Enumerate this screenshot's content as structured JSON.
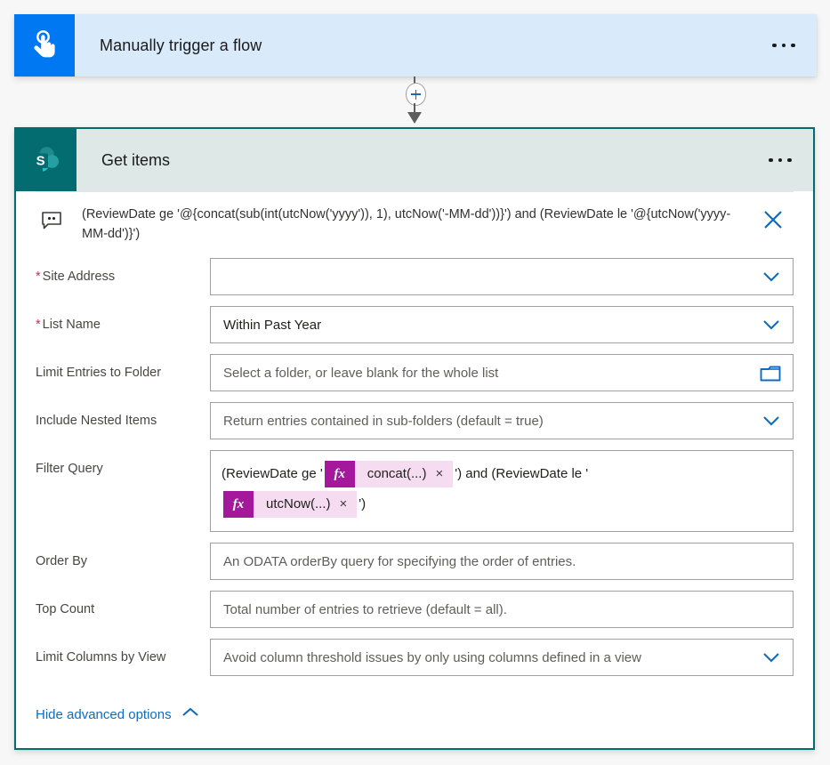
{
  "trigger": {
    "title": "Manually trigger a flow",
    "icon": "hand-tap-icon",
    "icon_bg": "#0078f2",
    "header_bg": "#d9eafa",
    "menu_label": "More commands"
  },
  "connector": {
    "add_label": "+",
    "icon": "plus-icon",
    "accent": "#0f6cbd"
  },
  "action": {
    "title": "Get items",
    "icon": "sharepoint-icon",
    "icon_bg": "#036c70",
    "header_bg": "#dde8e7",
    "border_color": "#036c70",
    "menu_label": "More commands",
    "tooltip": {
      "icon": "comment-bubble-icon",
      "text": "(ReviewDate ge '@{concat(sub(int(utcNow('yyyy')), 1), utcNow('-MM-dd'))}') and (ReviewDate le '@{utcNow('yyyy-MM-dd')}')",
      "close_label": "×",
      "close_color": "#0f6cbd"
    },
    "fields": [
      {
        "label": "Site Address",
        "required": true,
        "value": "",
        "placeholder": "",
        "control": "dropdown"
      },
      {
        "label": "List Name",
        "required": true,
        "value": "Within Past Year",
        "placeholder": "",
        "control": "dropdown"
      },
      {
        "label": "Limit Entries to Folder",
        "required": false,
        "value": "",
        "placeholder": "Select a folder, or leave blank for the whole list",
        "control": "folder-picker"
      },
      {
        "label": "Include Nested Items",
        "required": false,
        "value": "",
        "placeholder": "Return entries contained in sub-folders (default = true)",
        "control": "dropdown"
      }
    ],
    "filter_query": {
      "label": "Filter Query",
      "segments": [
        {
          "kind": "text",
          "value": "(ReviewDate ge '"
        },
        {
          "kind": "chip",
          "fx": "fx",
          "value": "concat(...)",
          "remove": "×"
        },
        {
          "kind": "text",
          "value": "') and (ReviewDate le '"
        },
        {
          "kind": "break"
        },
        {
          "kind": "chip",
          "fx": "fx",
          "value": "utcNow(...)",
          "remove": "×"
        },
        {
          "kind": "text",
          "value": "')"
        }
      ],
      "chip_fx_bg": "#a4199c",
      "chip_body_bg": "#f6dcf1"
    },
    "fields_tail": [
      {
        "label": "Order By",
        "required": false,
        "value": "",
        "placeholder": "An ODATA orderBy query for specifying the order of entries.",
        "control": "text"
      },
      {
        "label": "Top Count",
        "required": false,
        "value": "",
        "placeholder": "Total number of entries to retrieve (default = all).",
        "control": "text"
      },
      {
        "label": "Limit Columns by View",
        "required": false,
        "value": "",
        "placeholder": "Avoid column threshold issues by only using columns defined in a view",
        "control": "dropdown"
      }
    ],
    "advanced_toggle": {
      "label": "Hide advanced options",
      "icon": "chevron-up-icon",
      "color": "#0f6cbd"
    }
  }
}
